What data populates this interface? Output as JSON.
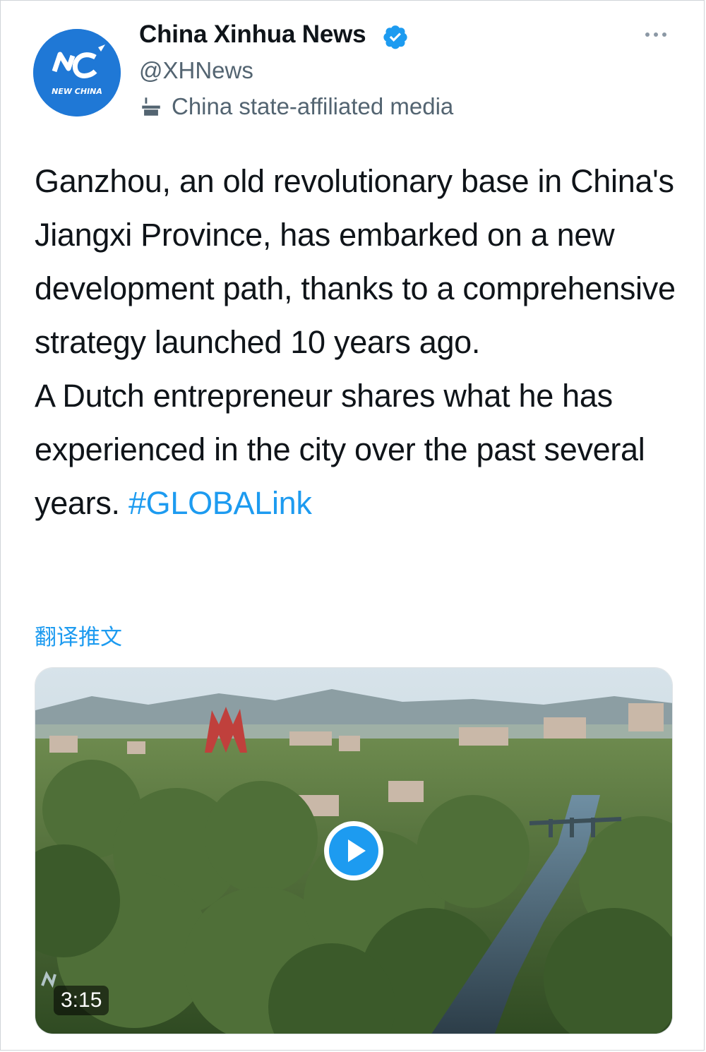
{
  "tweet": {
    "author": {
      "name": "China Xinhua News",
      "handle": "@XHNews",
      "label": "China state-affiliated media",
      "avatar_text": "NEW CHINA",
      "verified_icon": "verified-badge-icon",
      "label_icon": "state-media-podium-icon"
    },
    "text": {
      "paragraph1": "Ganzhou, an old revolutionary base in China's Jiangxi Province, has embarked on a new development path, thanks to a comprehensive strategy launched 10 years ago.",
      "paragraph2": "A Dutch entrepreneur shares what he has experienced in the city over the past several years.",
      "hashtag": "#GLOBALink"
    },
    "translate_label": "翻译推文",
    "media": {
      "type": "video",
      "duration": "3:15",
      "play_icon": "play-icon"
    },
    "more_icon": "more-options-icon"
  },
  "colors": {
    "accent": "#1d9bf0",
    "text": "#0f1419",
    "secondary": "#536471",
    "avatar_bg": "#1f78d6"
  }
}
